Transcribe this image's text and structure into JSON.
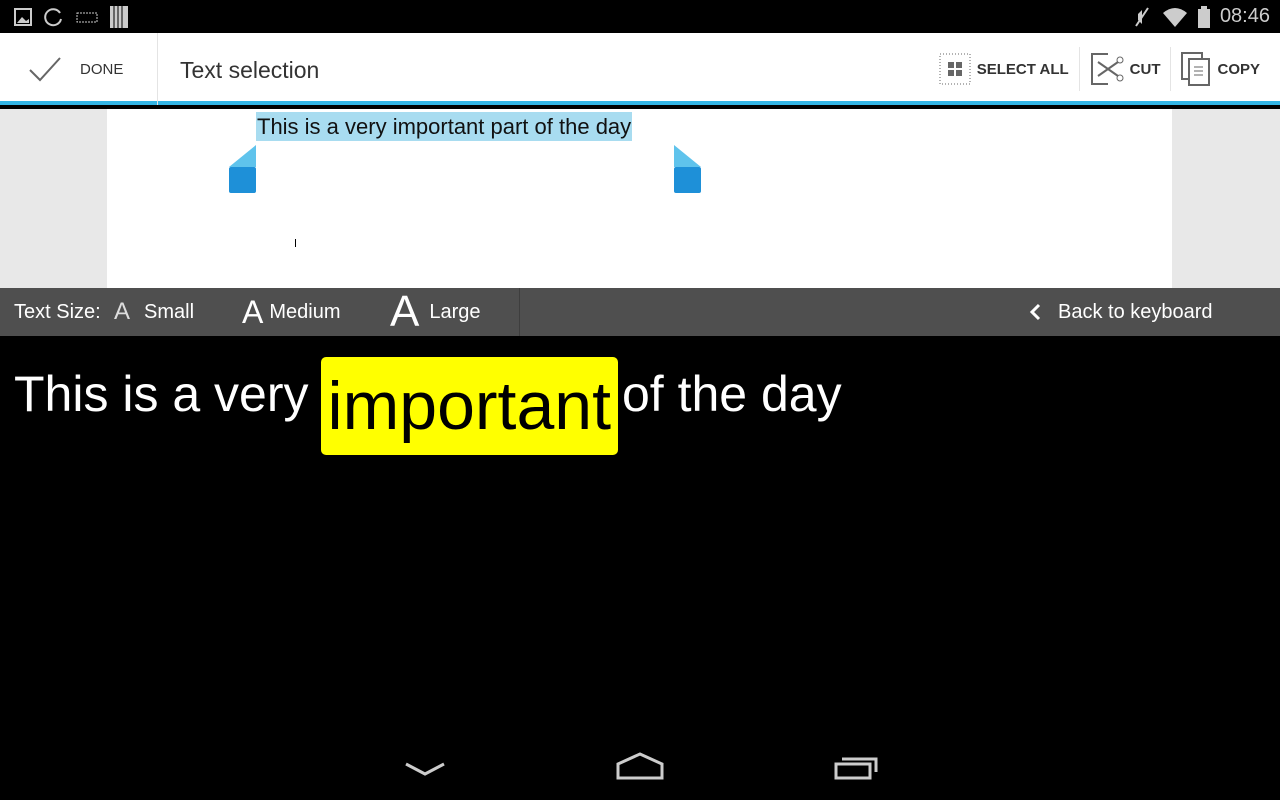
{
  "status_bar": {
    "time": "08:46",
    "icons_left": [
      "gallery-icon",
      "sync-icon",
      "keyboard-icon",
      "barcode-icon"
    ],
    "icons_right": [
      "mute-icon",
      "wifi-icon",
      "battery-icon"
    ]
  },
  "action_bar": {
    "done_label": "DONE",
    "title": "Text selection",
    "select_all_label": "SELECT ALL",
    "cut_label": "CUT",
    "copy_label": "COPY",
    "accent": "#33b5e5"
  },
  "editor": {
    "selected_text": "This is a very important part of the day",
    "selection_color": "#a8dcf0"
  },
  "text_size_bar": {
    "label": "Text Size:",
    "small": "Small",
    "medium": "Medium",
    "large": "Large",
    "back": "Back to keyboard",
    "glyph": "A"
  },
  "magnifier": {
    "before": "This is a very",
    "highlight": "important",
    "after": "of the day",
    "highlight_color": "#ffff00"
  },
  "nav_bar": {
    "icons": [
      "back-icon",
      "home-icon",
      "recents-icon"
    ]
  }
}
